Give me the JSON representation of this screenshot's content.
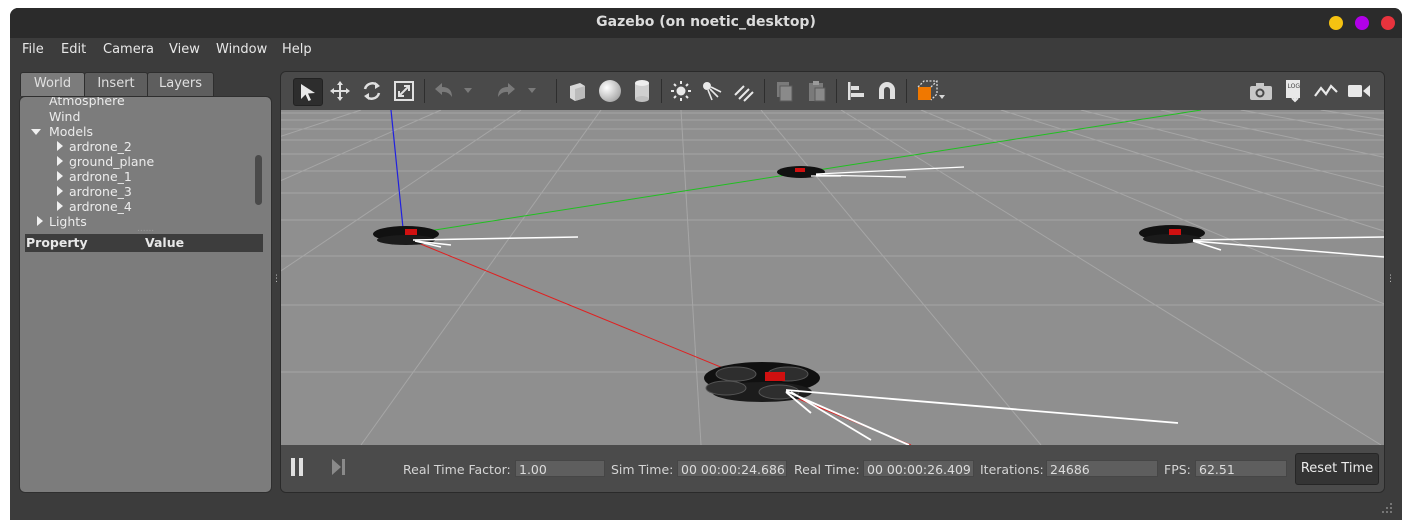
{
  "window": {
    "title": "Gazebo (on noetic_desktop)",
    "controls": {
      "minimize_color": "#f5c211",
      "maximize_color": "#b100e8",
      "close_color": "#e8333d"
    }
  },
  "menubar": {
    "items": [
      {
        "label": "File"
      },
      {
        "label": "Edit"
      },
      {
        "label": "Camera"
      },
      {
        "label": "View"
      },
      {
        "label": "Window"
      },
      {
        "label": "Help"
      }
    ]
  },
  "left_panel": {
    "tabs": [
      {
        "label": "World",
        "active": true
      },
      {
        "label": "Insert",
        "active": false
      },
      {
        "label": "Layers",
        "active": false
      }
    ],
    "tree": {
      "atmosphere": "Atmosphere",
      "wind": "Wind",
      "models": "Models",
      "model_items": [
        "ardrone_2",
        "ground_plane",
        "ardrone_1",
        "ardrone_3",
        "ardrone_4"
      ],
      "lights": "Lights"
    },
    "property_table": {
      "col_property": "Property",
      "col_value": "Value"
    }
  },
  "toolbar": {
    "icons": [
      "select-arrow-icon",
      "translate-icon",
      "rotate-icon",
      "scale-icon",
      "undo-icon",
      "redo-icon",
      "box-icon",
      "sphere-icon",
      "cylinder-icon",
      "point-light-icon",
      "spot-light-icon",
      "directional-light-icon",
      "copy-icon",
      "paste-icon",
      "align-icon",
      "snap-icon",
      "view-angle-icon",
      "screenshot-icon",
      "log-icon",
      "plot-icon",
      "video-record-icon"
    ]
  },
  "bottom_bar": {
    "real_time_factor_label": "Real Time Factor:",
    "real_time_factor_value": "1.00",
    "sim_time_label": "Sim Time:",
    "sim_time_value": "00 00:00:24.686",
    "real_time_label": "Real Time:",
    "real_time_value": "00 00:00:26.409",
    "iterations_label": "Iterations:",
    "iterations_value": "24686",
    "fps_label": "FPS:",
    "fps_value": "62.51",
    "reset_time_label": "Reset Time"
  },
  "colors": {
    "accent_orange": "#f07800",
    "grid_background": "#8f8f8f",
    "axis_x": "#e02020",
    "axis_y": "#20d020",
    "axis_z": "#2020e0"
  }
}
